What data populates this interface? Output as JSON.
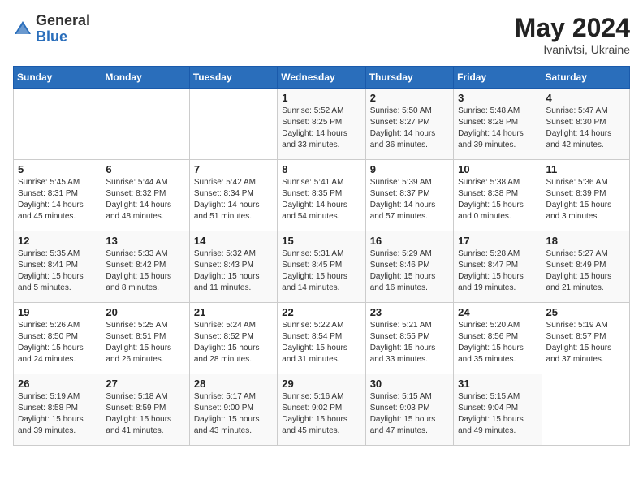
{
  "header": {
    "logo_general": "General",
    "logo_blue": "Blue",
    "title": "May 2024",
    "location": "Ivanivtsi, Ukraine"
  },
  "weekdays": [
    "Sunday",
    "Monday",
    "Tuesday",
    "Wednesday",
    "Thursday",
    "Friday",
    "Saturday"
  ],
  "weeks": [
    [
      {
        "day": "",
        "info": ""
      },
      {
        "day": "",
        "info": ""
      },
      {
        "day": "",
        "info": ""
      },
      {
        "day": "1",
        "info": "Sunrise: 5:52 AM\nSunset: 8:25 PM\nDaylight: 14 hours\nand 33 minutes."
      },
      {
        "day": "2",
        "info": "Sunrise: 5:50 AM\nSunset: 8:27 PM\nDaylight: 14 hours\nand 36 minutes."
      },
      {
        "day": "3",
        "info": "Sunrise: 5:48 AM\nSunset: 8:28 PM\nDaylight: 14 hours\nand 39 minutes."
      },
      {
        "day": "4",
        "info": "Sunrise: 5:47 AM\nSunset: 8:30 PM\nDaylight: 14 hours\nand 42 minutes."
      }
    ],
    [
      {
        "day": "5",
        "info": "Sunrise: 5:45 AM\nSunset: 8:31 PM\nDaylight: 14 hours\nand 45 minutes."
      },
      {
        "day": "6",
        "info": "Sunrise: 5:44 AM\nSunset: 8:32 PM\nDaylight: 14 hours\nand 48 minutes."
      },
      {
        "day": "7",
        "info": "Sunrise: 5:42 AM\nSunset: 8:34 PM\nDaylight: 14 hours\nand 51 minutes."
      },
      {
        "day": "8",
        "info": "Sunrise: 5:41 AM\nSunset: 8:35 PM\nDaylight: 14 hours\nand 54 minutes."
      },
      {
        "day": "9",
        "info": "Sunrise: 5:39 AM\nSunset: 8:37 PM\nDaylight: 14 hours\nand 57 minutes."
      },
      {
        "day": "10",
        "info": "Sunrise: 5:38 AM\nSunset: 8:38 PM\nDaylight: 15 hours\nand 0 minutes."
      },
      {
        "day": "11",
        "info": "Sunrise: 5:36 AM\nSunset: 8:39 PM\nDaylight: 15 hours\nand 3 minutes."
      }
    ],
    [
      {
        "day": "12",
        "info": "Sunrise: 5:35 AM\nSunset: 8:41 PM\nDaylight: 15 hours\nand 5 minutes."
      },
      {
        "day": "13",
        "info": "Sunrise: 5:33 AM\nSunset: 8:42 PM\nDaylight: 15 hours\nand 8 minutes."
      },
      {
        "day": "14",
        "info": "Sunrise: 5:32 AM\nSunset: 8:43 PM\nDaylight: 15 hours\nand 11 minutes."
      },
      {
        "day": "15",
        "info": "Sunrise: 5:31 AM\nSunset: 8:45 PM\nDaylight: 15 hours\nand 14 minutes."
      },
      {
        "day": "16",
        "info": "Sunrise: 5:29 AM\nSunset: 8:46 PM\nDaylight: 15 hours\nand 16 minutes."
      },
      {
        "day": "17",
        "info": "Sunrise: 5:28 AM\nSunset: 8:47 PM\nDaylight: 15 hours\nand 19 minutes."
      },
      {
        "day": "18",
        "info": "Sunrise: 5:27 AM\nSunset: 8:49 PM\nDaylight: 15 hours\nand 21 minutes."
      }
    ],
    [
      {
        "day": "19",
        "info": "Sunrise: 5:26 AM\nSunset: 8:50 PM\nDaylight: 15 hours\nand 24 minutes."
      },
      {
        "day": "20",
        "info": "Sunrise: 5:25 AM\nSunset: 8:51 PM\nDaylight: 15 hours\nand 26 minutes."
      },
      {
        "day": "21",
        "info": "Sunrise: 5:24 AM\nSunset: 8:52 PM\nDaylight: 15 hours\nand 28 minutes."
      },
      {
        "day": "22",
        "info": "Sunrise: 5:22 AM\nSunset: 8:54 PM\nDaylight: 15 hours\nand 31 minutes."
      },
      {
        "day": "23",
        "info": "Sunrise: 5:21 AM\nSunset: 8:55 PM\nDaylight: 15 hours\nand 33 minutes."
      },
      {
        "day": "24",
        "info": "Sunrise: 5:20 AM\nSunset: 8:56 PM\nDaylight: 15 hours\nand 35 minutes."
      },
      {
        "day": "25",
        "info": "Sunrise: 5:19 AM\nSunset: 8:57 PM\nDaylight: 15 hours\nand 37 minutes."
      }
    ],
    [
      {
        "day": "26",
        "info": "Sunrise: 5:19 AM\nSunset: 8:58 PM\nDaylight: 15 hours\nand 39 minutes."
      },
      {
        "day": "27",
        "info": "Sunrise: 5:18 AM\nSunset: 8:59 PM\nDaylight: 15 hours\nand 41 minutes."
      },
      {
        "day": "28",
        "info": "Sunrise: 5:17 AM\nSunset: 9:00 PM\nDaylight: 15 hours\nand 43 minutes."
      },
      {
        "day": "29",
        "info": "Sunrise: 5:16 AM\nSunset: 9:02 PM\nDaylight: 15 hours\nand 45 minutes."
      },
      {
        "day": "30",
        "info": "Sunrise: 5:15 AM\nSunset: 9:03 PM\nDaylight: 15 hours\nand 47 minutes."
      },
      {
        "day": "31",
        "info": "Sunrise: 5:15 AM\nSunset: 9:04 PM\nDaylight: 15 hours\nand 49 minutes."
      },
      {
        "day": "",
        "info": ""
      }
    ]
  ]
}
